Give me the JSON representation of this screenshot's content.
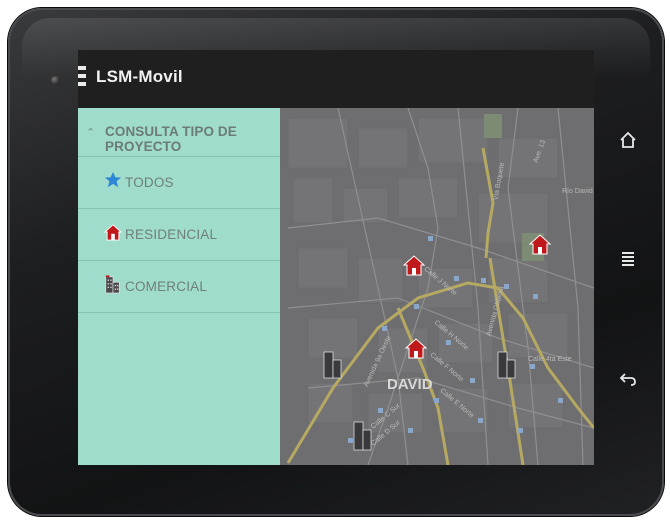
{
  "app": {
    "title": "LSM-Movil"
  },
  "drawer": {
    "header": "CONSULTA TIPO DE PROYECTO",
    "items": [
      {
        "label": "TODOS",
        "icon": "star-icon"
      },
      {
        "label": "RESIDENCIAL",
        "icon": "house-icon"
      },
      {
        "label": "COMERCIAL",
        "icon": "building-icon"
      }
    ]
  },
  "map": {
    "city_label": "DAVID",
    "street_labels": [
      "Calle 4ta Este",
      "Avenida Obaldia",
      "Avenida 9a Oeste",
      "Calle J Norte",
      "Calle H Norte",
      "Calle F Norte",
      "Calle E Norte",
      "Calle C Sur",
      "Calle D Sur",
      "Vía Boquete",
      "Río David",
      "Ave. 13"
    ]
  },
  "colors": {
    "drawer_bg": "#9fdccb",
    "appbar_bg": "#1f1f1f",
    "road": "#b6a962",
    "house": "#c0191c"
  }
}
